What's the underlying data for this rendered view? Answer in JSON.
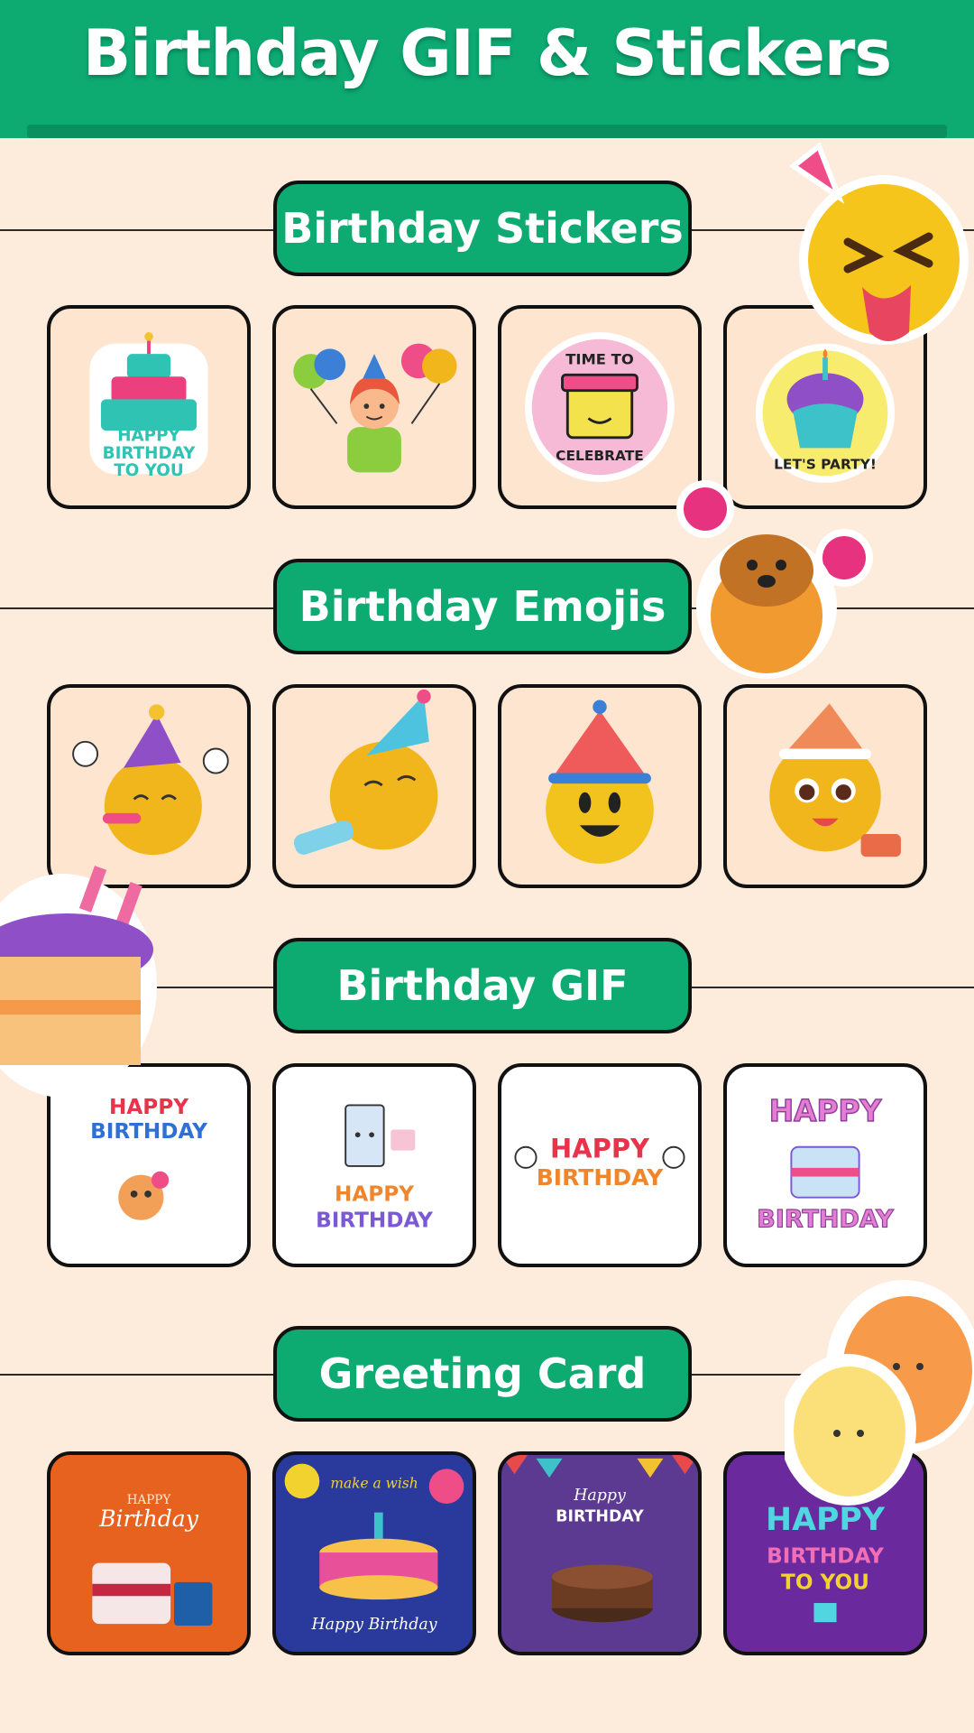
{
  "app_title": "Birthday GIF & Stickers",
  "colors": {
    "accent": "#0daa72",
    "background": "#fdebdc",
    "tile_bg": "#fde5d0"
  },
  "sections": [
    {
      "title": "Birthday Stickers",
      "items": [
        {
          "icon": "cake-sticker-icon",
          "text": [
            "HAPPY",
            "BIRTHDAY",
            "TO YOU"
          ]
        },
        {
          "icon": "girl-with-balloons-icon"
        },
        {
          "icon": "gift-box-icon",
          "text": [
            "TIME TO",
            "CELEBRATE"
          ]
        },
        {
          "icon": "cupcake-icon",
          "text": [
            "LET'S PARTY!"
          ]
        }
      ]
    },
    {
      "title": "Birthday Emojis",
      "items": [
        {
          "icon": "party-emoji-blower-icon"
        },
        {
          "icon": "party-emoji-horn-icon"
        },
        {
          "icon": "party-emoji-smile-icon"
        },
        {
          "icon": "party-emoji-cake-icon"
        }
      ]
    },
    {
      "title": "Birthday GIF",
      "items": [
        {
          "icon": "happy-birthday-gif-icon",
          "text": [
            "HAPPY",
            "BIRTHDAY"
          ]
        },
        {
          "icon": "milk-carton-gif-icon",
          "text": [
            "HAPPY",
            "BIRTHDAY"
          ]
        },
        {
          "icon": "happy-birthday-text-gif-icon",
          "text": [
            "HAPPY",
            "BIRTHDAY"
          ]
        },
        {
          "icon": "cake-gif-icon",
          "text": [
            "HAPPY",
            "BIRTHDAY"
          ]
        }
      ]
    },
    {
      "title": "Greeting Card",
      "items": [
        {
          "icon": "orange-card-icon",
          "text": [
            "HAPPY",
            "Birthday"
          ]
        },
        {
          "icon": "blue-card-icon",
          "text": [
            "make a wish",
            "Happy Birthday"
          ]
        },
        {
          "icon": "purple-card-icon",
          "text": [
            "Happy",
            "BIRTHDAY"
          ]
        },
        {
          "icon": "violet-card-icon",
          "text": [
            "HAPPY",
            "BIRTHDAY",
            "TO YOU"
          ]
        }
      ]
    }
  ]
}
